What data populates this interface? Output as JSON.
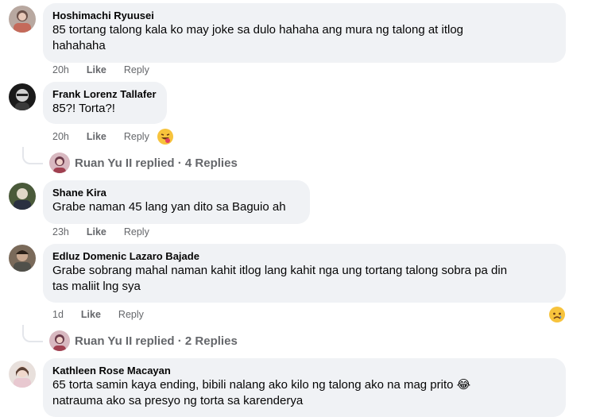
{
  "comments": [
    {
      "author": "Hoshimachi Ryuusei",
      "text_lines": [
        "85 tortang talong kala ko may joke sa dulo hahaha ang mura ng talong at itlog",
        "hahahaha"
      ],
      "time": "20h",
      "like": "Like",
      "reply": "Reply"
    },
    {
      "author": "Frank Lorenz Tallafer",
      "text_lines": [
        "85?! Torta?!"
      ],
      "time": "20h",
      "like": "Like",
      "reply": "Reply",
      "reaction": "haha-tongue-emoji",
      "replies": {
        "summary": "Ruan Yu II replied · 4 Replies"
      }
    },
    {
      "author": "Shane Kira",
      "text_lines": [
        "Grabe naman 45 lang yan dito sa Baguio ah"
      ],
      "time": "23h",
      "like": "Like",
      "reply": "Reply"
    },
    {
      "author": "Edluz Domenic Lazaro Bajade",
      "text_lines": [
        "Grabe sobrang mahal naman kahit itlog lang kahit nga ung tortang talong sobra pa din",
        "tas maliit lng sya"
      ],
      "time": "1d",
      "like": "Like",
      "reply": "Reply",
      "reaction": "sad-emoji",
      "replies": {
        "summary": "Ruan Yu II replied · 2 Replies"
      }
    },
    {
      "author": "Kathleen Rose Macayan",
      "text_lines": [
        "65 torta samin kaya ending, bibili nalang ako kilo ng talong ako na mag prito 😂",
        "natrauma ako sa presyo ng torta sa karenderya"
      ]
    }
  ],
  "colors": {
    "bubble": "#f0f2f5",
    "meta": "#65676b",
    "text": "#050505"
  }
}
